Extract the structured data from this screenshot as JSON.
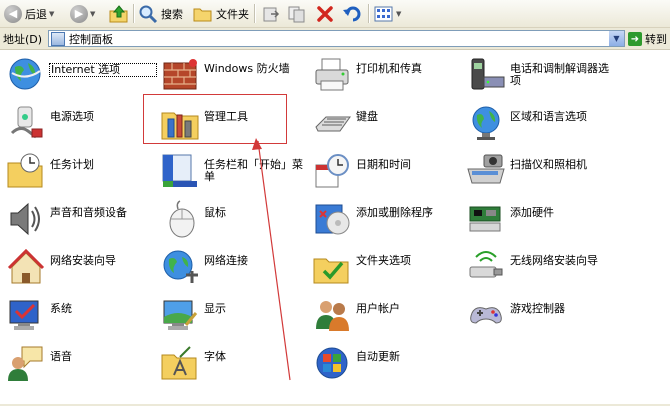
{
  "toolbar": {
    "back_label": "后退",
    "search_label": "搜索",
    "folders_label": "文件夹"
  },
  "address": {
    "label": "地址(D)",
    "value": "控制面板",
    "go_label": "转到"
  },
  "items": [
    {
      "label": "Internet 选项",
      "icon": "globe-icon"
    },
    {
      "label": "Windows 防火墙",
      "icon": "firewall-icon"
    },
    {
      "label": "打印机和传真",
      "icon": "printer-icon"
    },
    {
      "label": "电话和调制解调器选项",
      "icon": "phone-modem-icon"
    },
    {
      "label": "电源选项",
      "icon": "power-icon"
    },
    {
      "label": "管理工具",
      "icon": "admin-tools-icon"
    },
    {
      "label": "键盘",
      "icon": "keyboard-icon"
    },
    {
      "label": "区域和语言选项",
      "icon": "region-globe-icon"
    },
    {
      "label": "任务计划",
      "icon": "scheduled-tasks-icon"
    },
    {
      "label": "任务栏和「开始」菜单",
      "icon": "taskbar-icon"
    },
    {
      "label": "日期和时间",
      "icon": "clock-calendar-icon"
    },
    {
      "label": "扫描仪和照相机",
      "icon": "scanner-camera-icon"
    },
    {
      "label": "声音和音频设备",
      "icon": "speaker-icon"
    },
    {
      "label": "鼠标",
      "icon": "mouse-icon"
    },
    {
      "label": "添加或删除程序",
      "icon": "add-remove-programs-icon"
    },
    {
      "label": "添加硬件",
      "icon": "add-hardware-icon"
    },
    {
      "label": "网络安装向导",
      "icon": "network-wizard-icon"
    },
    {
      "label": "网络连接",
      "icon": "network-connections-icon"
    },
    {
      "label": "文件夹选项",
      "icon": "folder-options-icon"
    },
    {
      "label": "无线网络安装向导",
      "icon": "wireless-wizard-icon"
    },
    {
      "label": "系统",
      "icon": "system-icon"
    },
    {
      "label": "显示",
      "icon": "display-icon"
    },
    {
      "label": "用户帐户",
      "icon": "user-accounts-icon"
    },
    {
      "label": "游戏控制器",
      "icon": "game-controller-icon"
    },
    {
      "label": "语音",
      "icon": "speech-icon"
    },
    {
      "label": "字体",
      "icon": "fonts-folder-icon"
    },
    {
      "label": "自动更新",
      "icon": "auto-update-icon"
    }
  ]
}
